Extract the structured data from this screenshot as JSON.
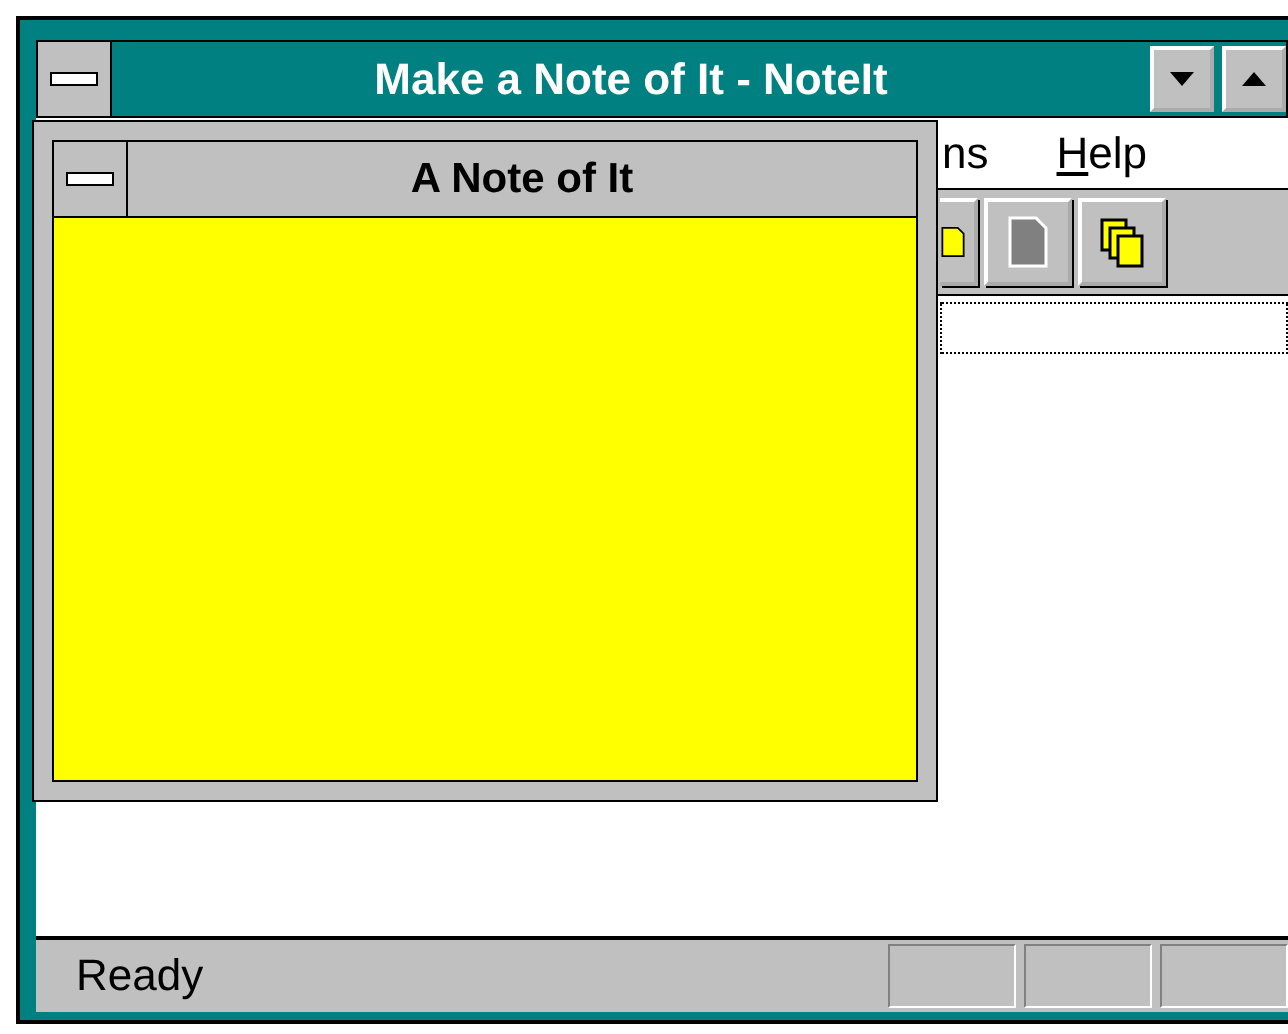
{
  "window": {
    "title": "Make a Note of It - NoteIt"
  },
  "menu": [
    {
      "label": "ns"
    },
    {
      "label": "Help"
    }
  ],
  "toolbar": [
    {
      "kind": "page",
      "disabled": false
    },
    {
      "kind": "page",
      "disabled": true
    },
    {
      "kind": "copy",
      "disabled": false
    }
  ],
  "note": {
    "title": "A Note of It"
  },
  "status_bar": {
    "text": "Ready"
  }
}
